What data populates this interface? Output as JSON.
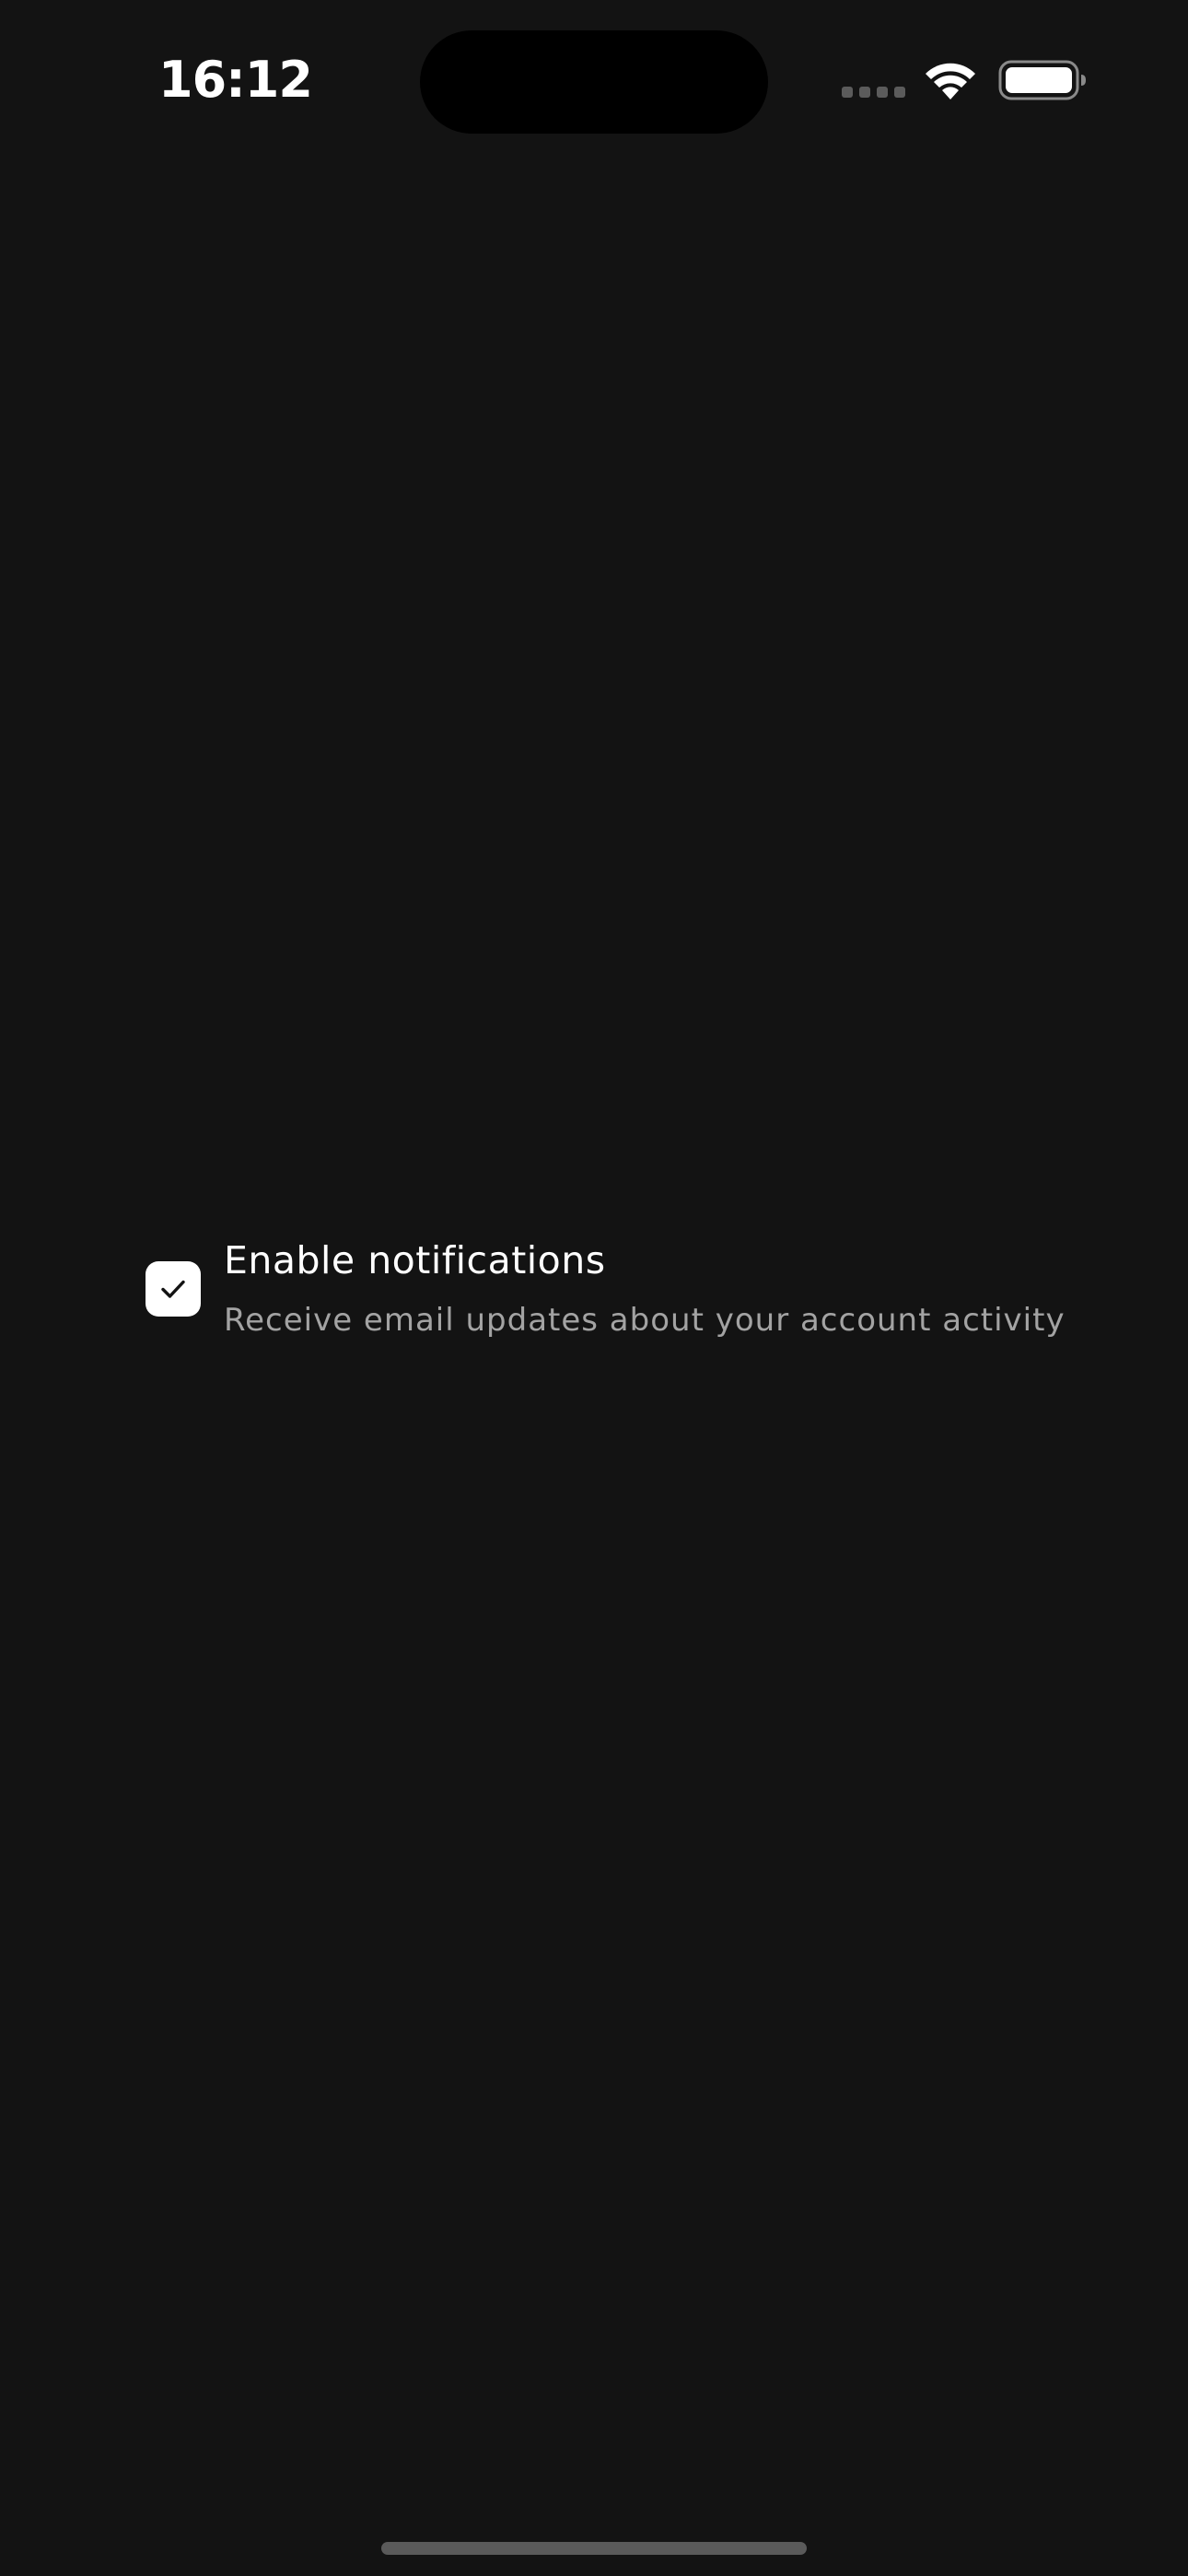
{
  "status_bar": {
    "time": "16:12",
    "icons": [
      "signal-icon",
      "wifi-icon",
      "battery-icon"
    ]
  },
  "notification_option": {
    "checked": true,
    "title": "Enable notifications",
    "description": "Receive email updates about your account activity",
    "checkmark_icon": "checkmark-icon"
  },
  "colors": {
    "background": "#131313",
    "checkbox_fill": "#ffffff",
    "description_text": "#a3a3a3"
  }
}
